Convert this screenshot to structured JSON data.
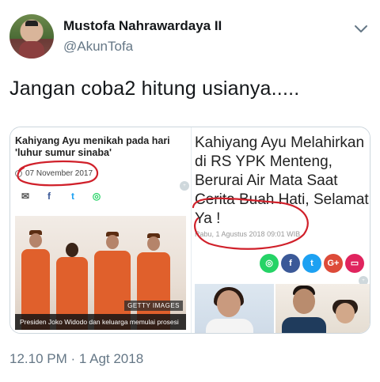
{
  "tweet": {
    "display_name": "Mustofa Nahrawardaya II",
    "handle": "@AkunTofa",
    "text": "Jangan coba2 hitung usianya.....",
    "timestamp": "12.10 PM · 1 Agt 2018",
    "menu_icon": "chevron-down-icon"
  },
  "left_article": {
    "title": "Kahiyang Ayu menikah pada hari 'luhur sumur sinaba'",
    "date": "07 November 2017",
    "share_icons": [
      "mail-icon",
      "facebook-icon",
      "twitter-icon",
      "whatsapp-icon"
    ],
    "photo_credit": "GETTY IMAGES",
    "caption": "Presiden Joko Widodo dan keluarga memulai prosesi"
  },
  "right_article": {
    "title": "Kahiyang Ayu Melahirkan di RS YPK Menteng, Berurai Air Mata Saat Cerita Buah Hati, Selamat Ya !",
    "date": "Rabu, 1 Agustus 2018 09:01 WIB",
    "share_buttons": [
      "whatsapp",
      "facebook",
      "twitter",
      "google-plus",
      "comment"
    ]
  },
  "colors": {
    "annotation_red": "#d0202a",
    "muted_text": "#657786",
    "card_border": "#ccd6dd"
  }
}
